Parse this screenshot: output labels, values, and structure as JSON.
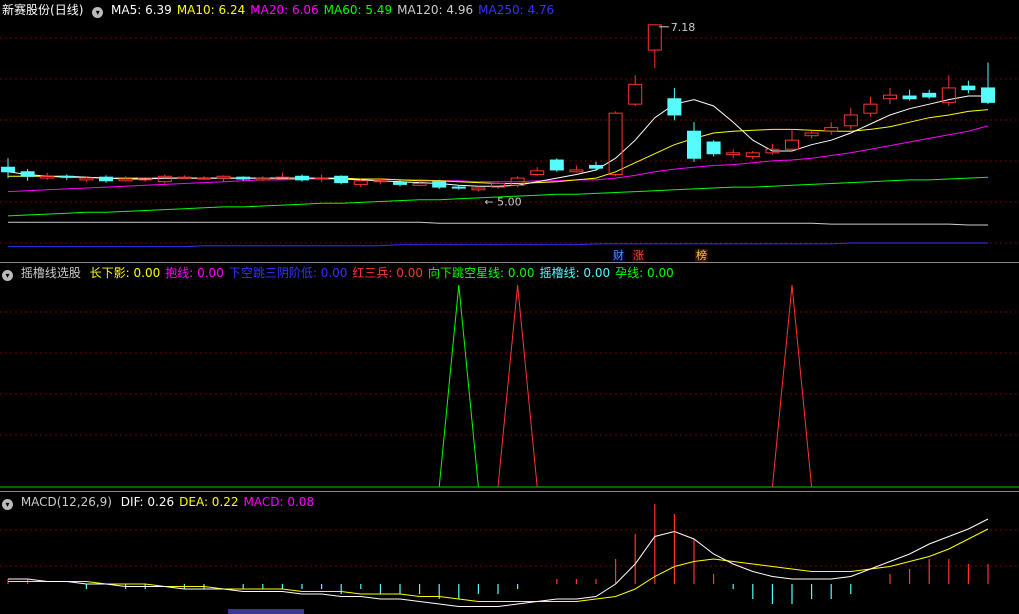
{
  "kline": {
    "stock": "新赛股份",
    "period": "(日线)",
    "legend": [
      {
        "label": "MA5:",
        "value": "6.39",
        "color": "#ffffff"
      },
      {
        "label": "MA10:",
        "value": "6.24",
        "color": "#ffff00"
      },
      {
        "label": "MA20:",
        "value": "6.06",
        "color": "#ff00ff"
      },
      {
        "label": "MA60:",
        "value": "5.49",
        "color": "#00ff00"
      },
      {
        "label": "MA120:",
        "value": "4.96",
        "color": "#cccccc"
      },
      {
        "label": "MA250:",
        "value": "4.76",
        "color": "#3333ff"
      }
    ],
    "high_label": "7.18",
    "low_label": "5.00",
    "badges": [
      {
        "text": "财",
        "color": "#5599ff",
        "bg": "#000033"
      },
      {
        "text": "涨",
        "color": "#ff4444",
        "bg": "#220000"
      },
      {
        "text": "榜",
        "color": "#ffcc44",
        "bg": "#331100"
      }
    ],
    "colors": {
      "up": "#ff3333",
      "down": "#54fcfc"
    }
  },
  "indicator": {
    "name": "摇橹线选股",
    "legend": [
      {
        "label": "长下影:",
        "value": "0.00",
        "color": "#ffff00"
      },
      {
        "label": "抱线:",
        "value": "0.00",
        "color": "#ff00ff"
      },
      {
        "label": "下空跳三阴阶低:",
        "value": "0.00",
        "color": "#3333ff"
      },
      {
        "label": "红三兵:",
        "value": "0.00",
        "color": "#ff3333"
      },
      {
        "label": "向下跳空星线:",
        "value": "0.00",
        "color": "#00ff00"
      },
      {
        "label": "摇橹线:",
        "value": "0.00",
        "color": "#54fcfc"
      },
      {
        "label": "孕线:",
        "value": "0.00",
        "color": "#00ff00"
      }
    ]
  },
  "macd": {
    "name": "MACD(12,26,9)",
    "legend": [
      {
        "label": "DIF:",
        "value": "0.26",
        "color": "#ffffff"
      },
      {
        "label": "DEA:",
        "value": "0.22",
        "color": "#ffff00"
      },
      {
        "label": "MACD:",
        "value": "0.08",
        "color": "#ff00ff"
      }
    ]
  },
  "chart_data": [
    {
      "type": "candlestick",
      "candles": [
        [
          5.6,
          5.55,
          5.7,
          5.48
        ],
        [
          5.55,
          5.5,
          5.58,
          5.45
        ],
        [
          5.48,
          5.5,
          5.54,
          5.46
        ],
        [
          5.5,
          5.49,
          5.52,
          5.46
        ],
        [
          5.46,
          5.48,
          5.5,
          5.44
        ],
        [
          5.49,
          5.45,
          5.51,
          5.43
        ],
        [
          5.45,
          5.47,
          5.5,
          5.44
        ],
        [
          5.46,
          5.48,
          5.49,
          5.44
        ],
        [
          5.44,
          5.5,
          5.52,
          5.42
        ],
        [
          5.48,
          5.49,
          5.51,
          5.47
        ],
        [
          5.48,
          5.48,
          5.5,
          5.46
        ],
        [
          5.48,
          5.5,
          5.51,
          5.44
        ],
        [
          5.49,
          5.47,
          5.5,
          5.45
        ],
        [
          5.46,
          5.48,
          5.5,
          5.45
        ],
        [
          5.47,
          5.49,
          5.54,
          5.46
        ],
        [
          5.5,
          5.46,
          5.52,
          5.44
        ],
        [
          5.47,
          5.48,
          5.52,
          5.44
        ],
        [
          5.5,
          5.43,
          5.51,
          5.41
        ],
        [
          5.41,
          5.45,
          5.47,
          5.38
        ],
        [
          5.45,
          5.45,
          5.48,
          5.41
        ],
        [
          5.43,
          5.41,
          5.46,
          5.39
        ],
        [
          5.4,
          5.42,
          5.44,
          5.39
        ],
        [
          5.44,
          5.38,
          5.46,
          5.36
        ],
        [
          5.38,
          5.37,
          5.4,
          5.35
        ],
        [
          5.35,
          5.37,
          5.39,
          5.33
        ],
        [
          5.38,
          5.42,
          5.44,
          5.36
        ],
        [
          5.4,
          5.48,
          5.5,
          5.38
        ],
        [
          5.52,
          5.56,
          5.6,
          5.5
        ],
        [
          5.68,
          5.57,
          5.7,
          5.55
        ],
        [
          5.55,
          5.57,
          5.62,
          5.54
        ],
        [
          5.62,
          5.59,
          5.66,
          5.56
        ],
        [
          5.52,
          6.2,
          6.22,
          5.5
        ],
        [
          6.3,
          6.52,
          6.62,
          6.28
        ],
        [
          6.9,
          7.18,
          7.18,
          6.7
        ],
        [
          6.36,
          6.18,
          6.48,
          6.12
        ],
        [
          6.0,
          5.7,
          6.1,
          5.66
        ],
        [
          5.88,
          5.75,
          5.9,
          5.72
        ],
        [
          5.74,
          5.76,
          5.8,
          5.7
        ],
        [
          5.72,
          5.76,
          5.78,
          5.69
        ],
        [
          5.76,
          5.8,
          5.86,
          5.74
        ],
        [
          5.8,
          5.9,
          6.02,
          5.78
        ],
        [
          5.95,
          5.98,
          6.0,
          5.92
        ],
        [
          6.0,
          6.04,
          6.1,
          5.96
        ],
        [
          6.06,
          6.18,
          6.26,
          6.02
        ],
        [
          6.2,
          6.3,
          6.38,
          6.16
        ],
        [
          6.36,
          6.4,
          6.48,
          6.3
        ],
        [
          6.39,
          6.36,
          6.46,
          6.34
        ],
        [
          6.42,
          6.38,
          6.46,
          6.36
        ],
        [
          6.32,
          6.48,
          6.62,
          6.28
        ],
        [
          6.5,
          6.46,
          6.56,
          6.42
        ],
        [
          6.48,
          6.32,
          6.76,
          6.3
        ]
      ],
      "ma5": [
        5.55,
        5.52,
        5.5,
        5.5,
        5.49,
        5.48,
        5.47,
        5.47,
        5.48,
        5.48,
        5.48,
        5.48,
        5.48,
        5.48,
        5.48,
        5.48,
        5.48,
        5.47,
        5.46,
        5.45,
        5.44,
        5.43,
        5.42,
        5.4,
        5.39,
        5.39,
        5.4,
        5.44,
        5.48,
        5.52,
        5.57,
        5.7,
        5.9,
        6.15,
        6.3,
        6.35,
        6.28,
        6.1,
        5.9,
        5.78,
        5.78,
        5.85,
        5.9,
        5.98,
        6.08,
        6.18,
        6.25,
        6.3,
        6.35,
        6.39,
        6.39
      ],
      "ma10": [
        5.5,
        5.5,
        5.5,
        5.49,
        5.49,
        5.48,
        5.48,
        5.48,
        5.48,
        5.48,
        5.48,
        5.48,
        5.48,
        5.48,
        5.48,
        5.48,
        5.48,
        5.48,
        5.47,
        5.47,
        5.46,
        5.45,
        5.45,
        5.44,
        5.43,
        5.42,
        5.42,
        5.43,
        5.44,
        5.46,
        5.48,
        5.55,
        5.65,
        5.75,
        5.85,
        5.92,
        5.98,
        6.0,
        6.01,
        6.02,
        6.02,
        6.01,
        6.0,
        6.0,
        6.02,
        6.05,
        6.1,
        6.15,
        6.18,
        6.22,
        6.24
      ],
      "ma20": [
        5.33,
        5.34,
        5.35,
        5.36,
        5.37,
        5.38,
        5.39,
        5.4,
        5.41,
        5.42,
        5.43,
        5.44,
        5.45,
        5.46,
        5.46,
        5.47,
        5.47,
        5.47,
        5.47,
        5.47,
        5.46,
        5.46,
        5.45,
        5.45,
        5.44,
        5.44,
        5.44,
        5.45,
        5.45,
        5.46,
        5.46,
        5.48,
        5.51,
        5.55,
        5.58,
        5.6,
        5.62,
        5.63,
        5.65,
        5.67,
        5.68,
        5.7,
        5.73,
        5.76,
        5.8,
        5.84,
        5.88,
        5.92,
        5.96,
        6.0,
        6.06
      ],
      "ma60": [
        5.06,
        5.07,
        5.08,
        5.09,
        5.1,
        5.1,
        5.11,
        5.12,
        5.13,
        5.14,
        5.15,
        5.16,
        5.16,
        5.17,
        5.18,
        5.19,
        5.2,
        5.2,
        5.21,
        5.22,
        5.23,
        5.24,
        5.24,
        5.25,
        5.26,
        5.27,
        5.28,
        5.29,
        5.3,
        5.3,
        5.31,
        5.32,
        5.33,
        5.34,
        5.35,
        5.36,
        5.37,
        5.38,
        5.38,
        5.39,
        5.4,
        5.41,
        5.42,
        5.43,
        5.44,
        5.45,
        5.46,
        5.46,
        5.47,
        5.48,
        5.49
      ],
      "ma120": [
        4.99,
        4.99,
        4.99,
        4.99,
        4.99,
        4.99,
        4.99,
        4.99,
        4.99,
        4.99,
        4.99,
        4.99,
        4.99,
        4.99,
        4.99,
        4.99,
        4.99,
        4.99,
        4.99,
        4.99,
        4.99,
        4.99,
        4.98,
        4.98,
        4.98,
        4.98,
        4.98,
        4.98,
        4.98,
        4.98,
        4.98,
        4.98,
        4.98,
        4.98,
        4.98,
        4.98,
        4.98,
        4.98,
        4.98,
        4.98,
        4.98,
        4.98,
        4.97,
        4.97,
        4.97,
        4.97,
        4.97,
        4.97,
        4.97,
        4.96,
        4.96
      ],
      "ma250": [
        4.72,
        4.72,
        4.72,
        4.72,
        4.72,
        4.72,
        4.72,
        4.72,
        4.72,
        4.72,
        4.73,
        4.73,
        4.73,
        4.73,
        4.73,
        4.73,
        4.73,
        4.73,
        4.73,
        4.73,
        4.74,
        4.74,
        4.74,
        4.74,
        4.74,
        4.74,
        4.74,
        4.74,
        4.74,
        4.74,
        4.75,
        4.75,
        4.75,
        4.75,
        4.75,
        4.75,
        4.75,
        4.75,
        4.75,
        4.75,
        4.75,
        4.75,
        4.75,
        4.76,
        4.76,
        4.76,
        4.76,
        4.76,
        4.76,
        4.76,
        4.76
      ],
      "ylim": [
        4.66,
        7.3
      ]
    },
    {
      "type": "line",
      "signals": [
        {
          "series": "向下跳空星线",
          "index": 23,
          "value": 1,
          "color": "#00ff00"
        },
        {
          "series": "红三兵",
          "index": 26,
          "value": 1,
          "color": "#ff3333"
        },
        {
          "series": "红三兵",
          "index": 40,
          "value": 1,
          "color": "#ff3333"
        }
      ],
      "ylim": [
        0,
        1
      ]
    },
    {
      "type": "bar",
      "dif": [
        0.02,
        0.02,
        0.01,
        0.01,
        0.0,
        0.0,
        -0.01,
        -0.01,
        -0.01,
        -0.02,
        -0.02,
        -0.02,
        -0.03,
        -0.03,
        -0.03,
        -0.04,
        -0.04,
        -0.05,
        -0.05,
        -0.06,
        -0.06,
        -0.07,
        -0.08,
        -0.09,
        -0.09,
        -0.09,
        -0.08,
        -0.07,
        -0.06,
        -0.06,
        -0.05,
        0.0,
        0.08,
        0.19,
        0.21,
        0.18,
        0.12,
        0.08,
        0.05,
        0.03,
        0.02,
        0.02,
        0.02,
        0.03,
        0.06,
        0.09,
        0.12,
        0.16,
        0.19,
        0.22,
        0.26
      ],
      "dea": [
        0.01,
        0.01,
        0.01,
        0.01,
        0.01,
        0.0,
        0.0,
        0.0,
        -0.01,
        -0.01,
        -0.01,
        -0.02,
        -0.02,
        -0.02,
        -0.02,
        -0.03,
        -0.03,
        -0.03,
        -0.04,
        -0.04,
        -0.04,
        -0.05,
        -0.05,
        -0.06,
        -0.07,
        -0.07,
        -0.07,
        -0.07,
        -0.07,
        -0.07,
        -0.06,
        -0.05,
        -0.02,
        0.03,
        0.07,
        0.09,
        0.1,
        0.09,
        0.08,
        0.07,
        0.06,
        0.05,
        0.05,
        0.05,
        0.06,
        0.07,
        0.09,
        0.11,
        0.14,
        0.18,
        0.22
      ],
      "macd": [
        0.02,
        0.02,
        0.0,
        0.0,
        -0.02,
        0.0,
        -0.02,
        -0.02,
        0.0,
        -0.02,
        -0.02,
        0.0,
        -0.02,
        -0.02,
        -0.02,
        -0.02,
        -0.02,
        -0.04,
        -0.02,
        -0.04,
        -0.04,
        -0.04,
        -0.06,
        -0.06,
        -0.04,
        -0.04,
        -0.02,
        0.0,
        0.02,
        0.02,
        0.02,
        0.1,
        0.2,
        0.32,
        0.28,
        0.18,
        0.04,
        -0.02,
        -0.06,
        -0.08,
        -0.08,
        -0.06,
        -0.06,
        -0.04,
        0.0,
        0.04,
        0.06,
        0.1,
        0.1,
        0.08,
        0.08
      ],
      "ylim": [
        -0.12,
        0.32
      ]
    }
  ]
}
